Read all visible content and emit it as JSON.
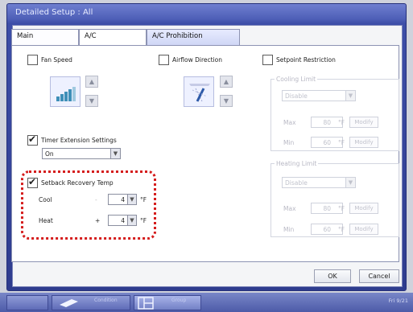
{
  "window": {
    "title": "Detailed Setup : All"
  },
  "tabs": [
    {
      "label": "Main"
    },
    {
      "label": "A/C"
    },
    {
      "label": "A/C Prohibition"
    }
  ],
  "fan_speed": {
    "label": "Fan Speed",
    "checked": false,
    "icon": "fan-speed-bars-icon"
  },
  "airflow_direction": {
    "label": "Airflow Direction",
    "checked": false,
    "icon": "airflow-louver-icon"
  },
  "setpoint_restriction": {
    "label": "Setpoint Restriction",
    "checked": false,
    "cooling": {
      "label": "Cooling Limit",
      "mode": "Disable",
      "max_label": "Max",
      "max_value": "80",
      "min_label": "Min",
      "min_value": "60",
      "unit": "°F",
      "modify_label": "Modify"
    },
    "heating": {
      "label": "Heating Limit",
      "mode": "Disable",
      "max_label": "Max",
      "max_value": "80",
      "min_label": "Min",
      "min_value": "60",
      "unit": "°F",
      "modify_label": "Modify"
    }
  },
  "timer_extension": {
    "label": "Timer Extension Settings",
    "checked": true,
    "value": "On"
  },
  "setback_recovery": {
    "label": "Setback Recovery Temp",
    "checked": true,
    "cool_label": "Cool",
    "cool_sign": "-",
    "cool_value": "4",
    "heat_label": "Heat",
    "heat_sign": "+",
    "heat_value": "4",
    "unit": "°F"
  },
  "buttons": {
    "ok": "OK",
    "cancel": "Cancel"
  },
  "taskbar": {
    "items": [
      {
        "label": "Condition"
      },
      {
        "label": "Group"
      }
    ],
    "clock": "Fri 9/21"
  },
  "colors": {
    "highlight": "#d51d1d",
    "title_bar": "#3d4ea8"
  }
}
